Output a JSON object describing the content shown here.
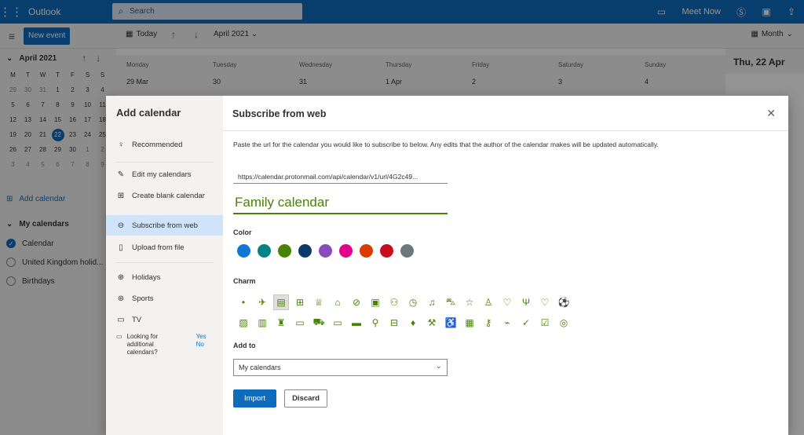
{
  "topbar": {
    "app_name": "Outlook",
    "search_placeholder": "Search",
    "meet_now": "Meet Now"
  },
  "toolbar": {
    "new_event": "New event",
    "today": "Today",
    "month_label": "April 2021",
    "view": "Month"
  },
  "mini_calendar": {
    "title": "April 2021",
    "weekdays": [
      "M",
      "T",
      "W",
      "T",
      "F",
      "S",
      "S"
    ],
    "rows": [
      [
        "29",
        "30",
        "31",
        "1",
        "2",
        "3",
        "4"
      ],
      [
        "5",
        "6",
        "7",
        "8",
        "9",
        "10",
        "11"
      ],
      [
        "12",
        "13",
        "14",
        "15",
        "16",
        "17",
        "18"
      ],
      [
        "19",
        "20",
        "21",
        "22",
        "23",
        "24",
        "25"
      ],
      [
        "26",
        "27",
        "28",
        "29",
        "30",
        "1",
        "2"
      ],
      [
        "3",
        "4",
        "5",
        "6",
        "7",
        "8",
        "9"
      ]
    ],
    "today": "22"
  },
  "left": {
    "add_calendar": "Add calendar",
    "my_calendars": "My calendars",
    "calendars": [
      "Calendar",
      "United Kingdom holid...",
      "Birthdays"
    ]
  },
  "calendar_header": {
    "days": [
      "Monday",
      "Tuesday",
      "Wednesday",
      "Thursday",
      "Friday",
      "Saturday",
      "Sunday"
    ],
    "dates": [
      "29 Mar",
      "30",
      "31",
      "1 Apr",
      "2",
      "3",
      "4"
    ],
    "side_date": "Thu, 22 Apr"
  },
  "dialog": {
    "nav_title": "Add calendar",
    "nav_items": {
      "recommended": "Recommended",
      "edit": "Edit my calendars",
      "blank": "Create blank calendar",
      "subscribe": "Subscribe from web",
      "upload": "Upload from file",
      "holidays": "Holidays",
      "sports": "Sports",
      "tv": "TV"
    },
    "looking": "Looking for additional calendars?",
    "looking_yes": "Yes",
    "looking_no": "No",
    "title": "Subscribe from web",
    "description": "Paste the url for the calendar you would like to subscribe to below. Any edits that the author of the calendar makes will be updated automatically.",
    "url_value": "https://calendar.protonmail.com/api/calendar/v1/url/4G2c49...",
    "name_value": "Family calendar",
    "color_label": "Color",
    "colors": [
      "#0f78d4",
      "#038387",
      "#498205",
      "#0e3a6b",
      "#8a4bbf",
      "#e3008c",
      "#da3b01",
      "#c50f1f",
      "#69797e"
    ],
    "charm_label": "Charm",
    "add_to_label": "Add to",
    "add_to_value": "My calendars",
    "import": "Import",
    "discard": "Discard"
  }
}
